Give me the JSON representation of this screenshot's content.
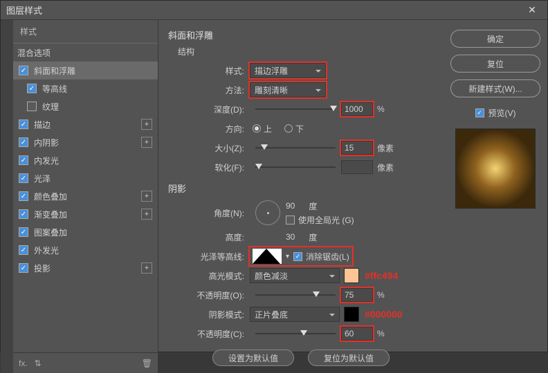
{
  "dialog": {
    "title": "图层样式"
  },
  "sidebar": {
    "header": "样式",
    "blend_opts": "混合选项",
    "items": [
      {
        "label": "斜面和浮雕",
        "checked": true,
        "selected": true,
        "plus": false,
        "sub": false
      },
      {
        "label": "等高线",
        "checked": true,
        "selected": false,
        "plus": false,
        "sub": true
      },
      {
        "label": "纹理",
        "checked": false,
        "selected": false,
        "plus": false,
        "sub": true
      },
      {
        "label": "描边",
        "checked": true,
        "selected": false,
        "plus": true,
        "sub": false
      },
      {
        "label": "内阴影",
        "checked": true,
        "selected": false,
        "plus": true,
        "sub": false
      },
      {
        "label": "内发光",
        "checked": true,
        "selected": false,
        "plus": false,
        "sub": false
      },
      {
        "label": "光泽",
        "checked": true,
        "selected": false,
        "plus": false,
        "sub": false
      },
      {
        "label": "颜色叠加",
        "checked": true,
        "selected": false,
        "plus": true,
        "sub": false
      },
      {
        "label": "渐变叠加",
        "checked": true,
        "selected": false,
        "plus": true,
        "sub": false
      },
      {
        "label": "图案叠加",
        "checked": true,
        "selected": false,
        "plus": false,
        "sub": false
      },
      {
        "label": "外发光",
        "checked": true,
        "selected": false,
        "plus": false,
        "sub": false
      },
      {
        "label": "投影",
        "checked": true,
        "selected": false,
        "plus": true,
        "sub": false
      }
    ]
  },
  "panel": {
    "title": "斜面和浮雕",
    "structure_label": "结构",
    "style_label": "样式:",
    "style_value": "描边浮雕",
    "method_label": "方法:",
    "method_value": "雕刻清晰",
    "depth_label": "深度(D):",
    "depth_value": "1000",
    "depth_unit": "%",
    "direction_label": "方向:",
    "direction_up": "上",
    "direction_down": "下",
    "size_label": "大小(Z):",
    "size_value": "15",
    "size_unit": "像素",
    "soften_label": "软化(F):",
    "soften_unit": "像素",
    "shadow_title": "阴影",
    "angle_label": "角度(N):",
    "angle_value": "90",
    "deg": "度",
    "global_light": "使用全局光 (G)",
    "altitude_label": "高度:",
    "altitude_value": "30",
    "gloss_label": "光泽等高线:",
    "antialias": "消除锯齿(L)",
    "highlight_mode_label": "高光模式:",
    "highlight_mode_value": "颜色减淡",
    "opacity_label": "不透明度(O):",
    "opacity_value": "75",
    "pct": "%",
    "shadow_mode_label": "阴影模式:",
    "shadow_mode_value": "正片叠底",
    "opacity2_label": "不透明度(C):",
    "opacity2_value": "60",
    "default_btn": "设置为默认值",
    "reset_btn": "复位为默认值",
    "hi_color_annot": "#ffc494",
    "sh_color_annot": "#000000"
  },
  "right": {
    "ok": "确定",
    "cancel": "复位",
    "new_style": "新建样式(W)...",
    "preview": "预览(V)"
  },
  "colors": {
    "highlight_swatch": "#ffc494",
    "shadow_swatch": "#000000"
  }
}
